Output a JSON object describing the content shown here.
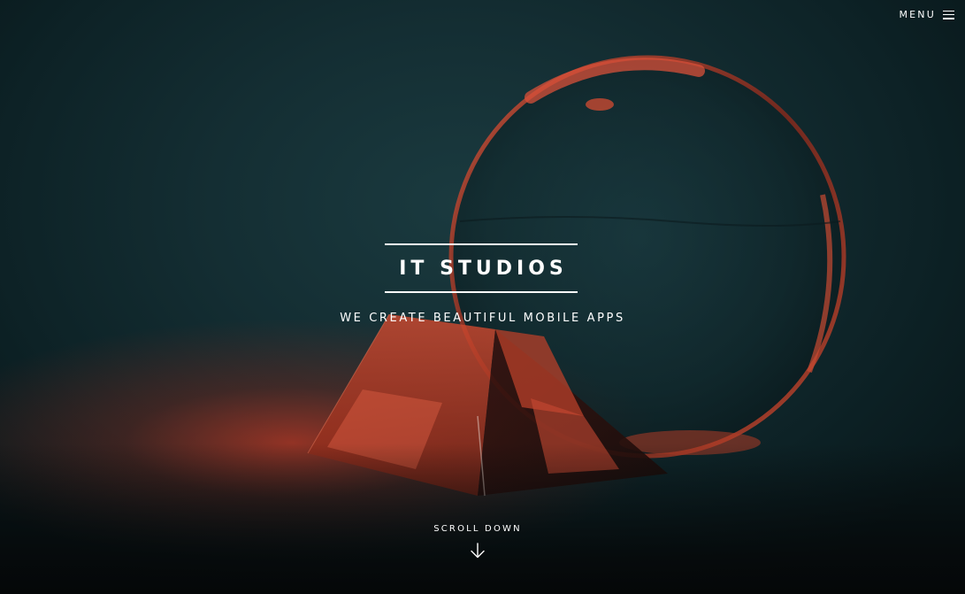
{
  "menu": {
    "label": "MENU",
    "icon": "hamburger-icon"
  },
  "hero": {
    "title": "IT STUDIOS",
    "tagline": "WE CREATE BEAUTIFUL MOBILE APPS"
  },
  "scroll": {
    "label": "SCROLL DOWN",
    "icon": "arrow-down-icon"
  },
  "colors": {
    "background": "#142e33",
    "accent_red": "#c23a22",
    "text": "#ffffff"
  }
}
